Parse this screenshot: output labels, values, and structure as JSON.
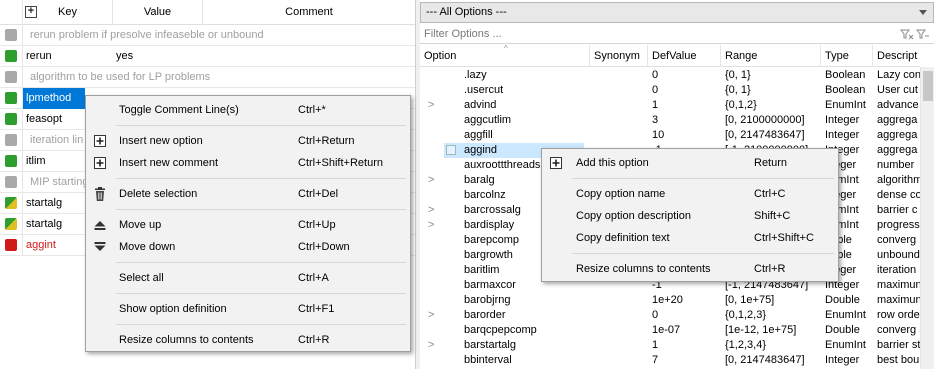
{
  "left_table": {
    "headers": {
      "key": "Key",
      "value": "Value",
      "comment": "Comment"
    },
    "rows": [
      {
        "type": "comment",
        "status": "gray",
        "text": "rerun problem if presolve infeaseble or unbound"
      },
      {
        "type": "option",
        "status": "green",
        "key": "rerun",
        "value": "yes"
      },
      {
        "type": "comment",
        "status": "gray",
        "text": "algorithm to be used for LP problems"
      },
      {
        "type": "option",
        "status": "green",
        "key": "lpmethod",
        "value": "",
        "selected": true
      },
      {
        "type": "option",
        "status": "green",
        "key": "feasopt",
        "value": ""
      },
      {
        "type": "comment",
        "status": "gray",
        "text": "iteration lin"
      },
      {
        "type": "option",
        "status": "green",
        "key": "itlim",
        "value": ""
      },
      {
        "type": "comment",
        "status": "gray",
        "text": "MIP starting"
      },
      {
        "type": "option",
        "status": "warn",
        "key": "startalg",
        "value": ""
      },
      {
        "type": "option",
        "status": "warn",
        "key": "startalg",
        "value": ""
      },
      {
        "type": "option",
        "status": "red",
        "key": "aggint",
        "value": "",
        "error": true
      }
    ]
  },
  "left_menu": {
    "items": [
      {
        "label": "Toggle Comment Line(s)",
        "shortcut": "Ctrl+*",
        "icon": ""
      },
      {
        "sep": true
      },
      {
        "label": "Insert new option",
        "shortcut": "Ctrl+Return",
        "icon": "plus-square-icon"
      },
      {
        "label": "Insert new comment",
        "shortcut": "Ctrl+Shift+Return",
        "icon": "plus-square-icon"
      },
      {
        "sep": true
      },
      {
        "label": "Delete selection",
        "shortcut": "Ctrl+Del",
        "icon": "trash-icon"
      },
      {
        "sep": true
      },
      {
        "label": "Move up",
        "shortcut": "Ctrl+Up",
        "icon": "move-up-icon"
      },
      {
        "label": "Move down",
        "shortcut": "Ctrl+Down",
        "icon": "move-down-icon"
      },
      {
        "sep": true
      },
      {
        "label": "Select all",
        "shortcut": "Ctrl+A",
        "icon": ""
      },
      {
        "sep": true
      },
      {
        "label": "Show option definition",
        "shortcut": "Ctrl+F1",
        "icon": ""
      },
      {
        "sep": true
      },
      {
        "label": "Resize columns to contents",
        "shortcut": "Ctrl+R",
        "icon": ""
      }
    ]
  },
  "right_panel": {
    "combo_value": "--- All Options ---",
    "filter_placeholder": "Filter Options ...",
    "headers": [
      "Option",
      "Synonym",
      "DefValue",
      "Range",
      "Type",
      "Descript"
    ],
    "rows": [
      {
        "exp": "",
        "option": ".lazy",
        "synonym": "",
        "def": "0",
        "range": "{0, 1}",
        "type": "Boolean",
        "desc": "Lazy con"
      },
      {
        "exp": "",
        "option": ".usercut",
        "synonym": "",
        "def": "0",
        "range": "{0, 1}",
        "type": "Boolean",
        "desc": "User cut"
      },
      {
        "exp": ">",
        "option": "advind",
        "synonym": "",
        "def": "1",
        "range": "{0,1,2}",
        "type": "EnumInt",
        "desc": "advance"
      },
      {
        "exp": "",
        "option": "aggcutlim",
        "synonym": "",
        "def": "3",
        "range": "[0, 2100000000]",
        "type": "Integer",
        "desc": "aggrega"
      },
      {
        "exp": "",
        "option": "aggfill",
        "synonym": "",
        "def": "10",
        "range": "[0, 2147483647]",
        "type": "Integer",
        "desc": "aggrega"
      },
      {
        "exp": "",
        "option": "aggind",
        "synonym": "",
        "def": "-1",
        "range": "[-1, 2100000000]",
        "type": "Integer",
        "desc": "aggrega",
        "selected": true
      },
      {
        "exp": "",
        "option": "auxroottthreads",
        "synonym": "",
        "def": "",
        "range": "",
        "type": "nteger",
        "desc": "number"
      },
      {
        "exp": ">",
        "option": "baralg",
        "synonym": "",
        "def": "",
        "range": "",
        "type": "numInt",
        "desc": "algorithm"
      },
      {
        "exp": "",
        "option": "barcolnz",
        "synonym": "",
        "def": "",
        "range": "",
        "type": "nteger",
        "desc": "dense co"
      },
      {
        "exp": ">",
        "option": "barcrossalg",
        "synonym": "",
        "def": "",
        "range": "",
        "type": "numInt",
        "desc": "barrier c"
      },
      {
        "exp": ">",
        "option": "bardisplay",
        "synonym": "",
        "def": "",
        "range": "",
        "type": "numInt",
        "desc": "progress"
      },
      {
        "exp": "",
        "option": "barepcomp",
        "synonym": "",
        "def": "",
        "range": "",
        "type": "ouble",
        "desc": "converg"
      },
      {
        "exp": "",
        "option": "bargrowth",
        "synonym": "",
        "def": "",
        "range": "",
        "type": "ouble",
        "desc": "unbound"
      },
      {
        "exp": "",
        "option": "baritlim",
        "synonym": "",
        "def": "",
        "range": "",
        "type": "nteger",
        "desc": "iteration"
      },
      {
        "exp": "",
        "option": "barmaxcor",
        "synonym": "",
        "def": "-1",
        "range": "[-1, 2147483647]",
        "type": "Integer",
        "desc": "maximun"
      },
      {
        "exp": "",
        "option": "barobjrng",
        "synonym": "",
        "def": "1e+20",
        "range": "[0, 1e+75]",
        "type": "Double",
        "desc": "maximun"
      },
      {
        "exp": ">",
        "option": "barorder",
        "synonym": "",
        "def": "0",
        "range": "{0,1,2,3}",
        "type": "EnumInt",
        "desc": "row orde"
      },
      {
        "exp": "",
        "option": "barqcpepcomp",
        "synonym": "",
        "def": "1e-07",
        "range": "[1e-12, 1e+75]",
        "type": "Double",
        "desc": "converg"
      },
      {
        "exp": ">",
        "option": "barstartalg",
        "synonym": "",
        "def": "1",
        "range": "{1,2,3,4}",
        "type": "EnumInt",
        "desc": "barrier st"
      },
      {
        "exp": "",
        "option": "bbinterval",
        "synonym": "",
        "def": "7",
        "range": "[0, 2147483647]",
        "type": "Integer",
        "desc": "best bou"
      }
    ]
  },
  "right_menu": {
    "items": [
      {
        "label": "Add this option",
        "shortcut": "Return",
        "icon": "plus-square-icon"
      },
      {
        "sep": true
      },
      {
        "label": "Copy option name",
        "shortcut": "Ctrl+C",
        "icon": ""
      },
      {
        "label": "Copy option description",
        "shortcut": "Shift+C",
        "icon": ""
      },
      {
        "label": "Copy definition text",
        "shortcut": "Ctrl+Shift+C",
        "icon": ""
      },
      {
        "sep": true
      },
      {
        "label": "Resize columns to contents",
        "shortcut": "Ctrl+R",
        "icon": ""
      }
    ]
  },
  "colors": {
    "green": "#2e9e2e",
    "gray": "#a9a9a9",
    "red": "#d01a1a",
    "warn_a": "#2e9e2e",
    "warn_b": "#e0c020",
    "selection": "#0078d7",
    "selection_light": "#cce8ff"
  }
}
